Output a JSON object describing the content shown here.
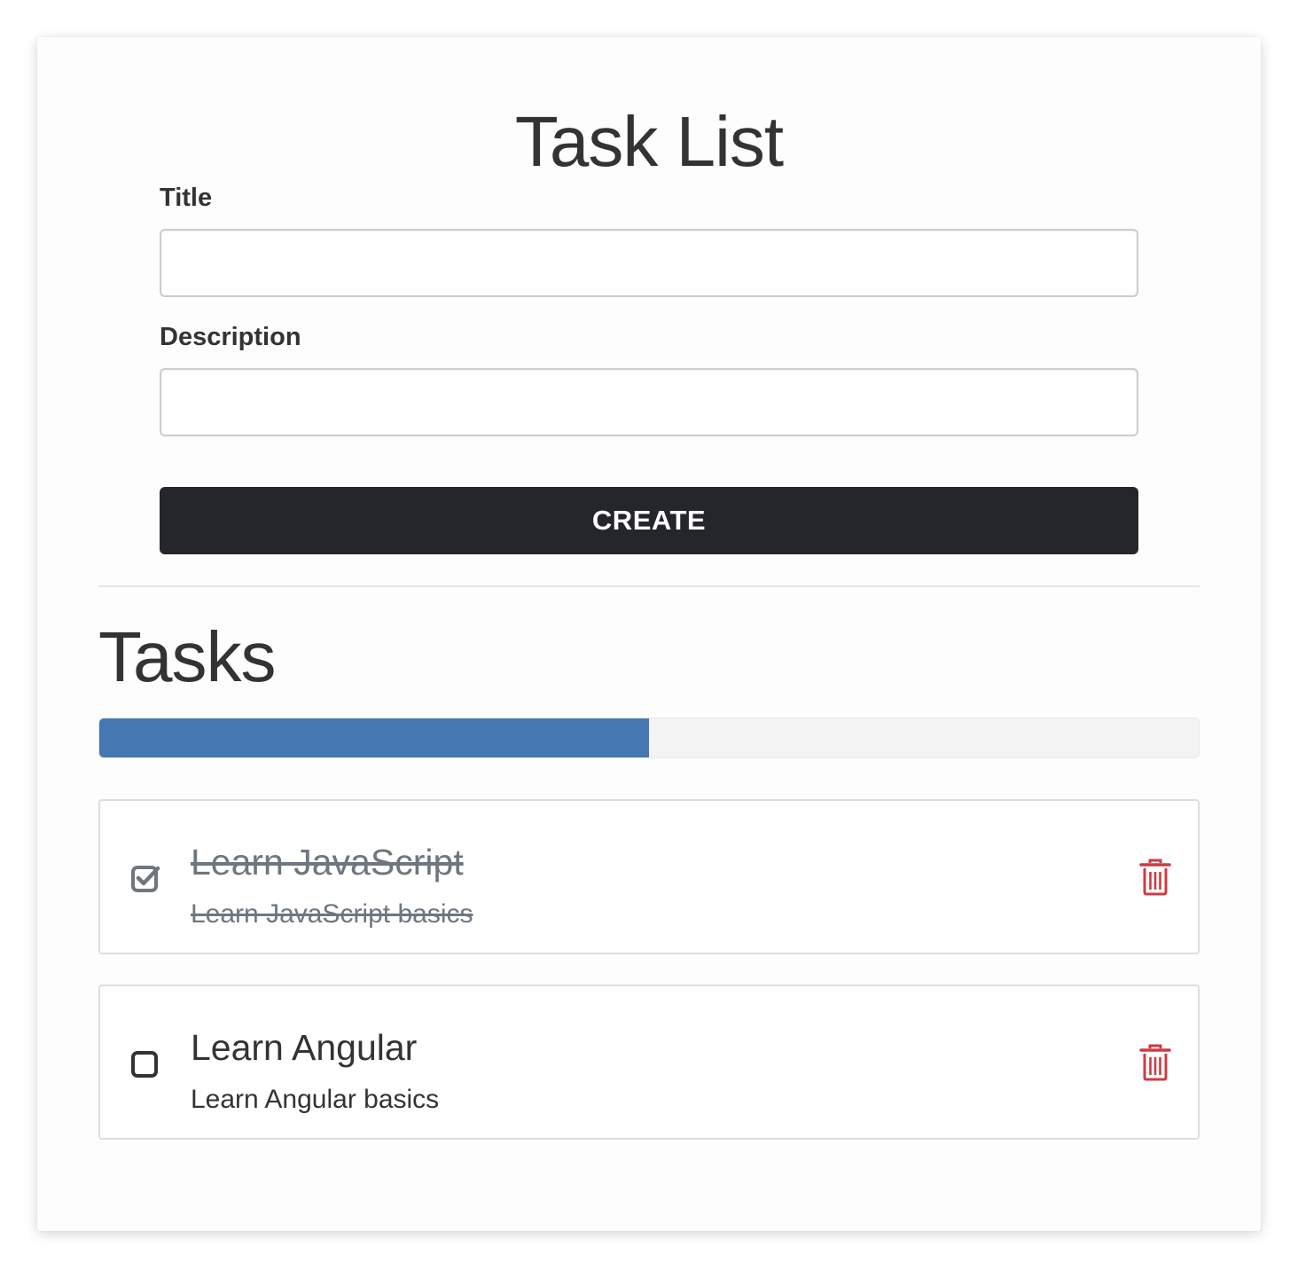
{
  "header": {
    "title": "Task List"
  },
  "form": {
    "title_label": "Title",
    "title_value": "",
    "description_label": "Description",
    "description_value": "",
    "create_label": "CREATE"
  },
  "tasks_section": {
    "title": "Tasks",
    "progress_percent": 50,
    "progress_color": "#4578b2"
  },
  "tasks": [
    {
      "title": "Learn JavaScript",
      "description": "Learn JavaScript basics",
      "completed": true,
      "checkbox_icon": "check-square-icon",
      "delete_icon": "trash-icon"
    },
    {
      "title": "Learn Angular",
      "description": "Learn Angular basics",
      "completed": false,
      "checkbox_icon": "square-icon",
      "delete_icon": "trash-icon"
    }
  ],
  "colors": {
    "button_bg": "#24262b",
    "delete": "#cc3b42",
    "completed_text": "#6e7780"
  }
}
